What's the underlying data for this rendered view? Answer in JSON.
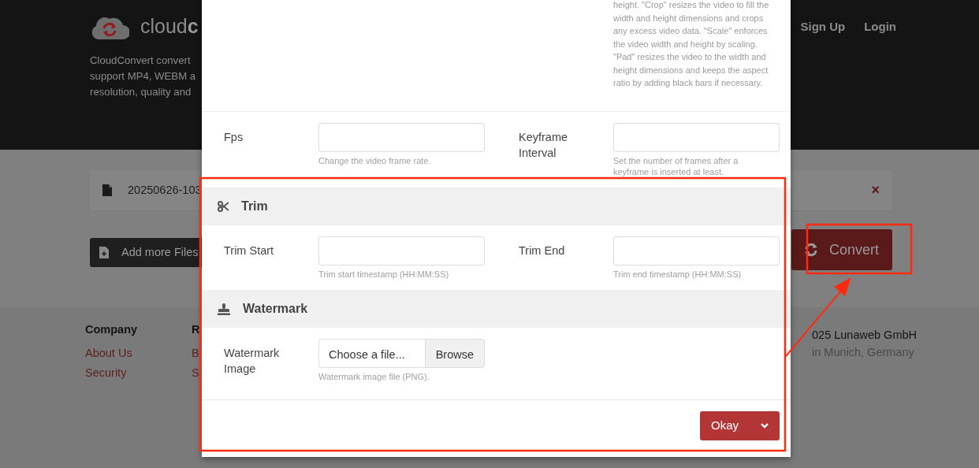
{
  "header": {
    "logo_text": "cloud**c**",
    "description": [
      "CloudConvert convert",
      "support MP4, WEBM a",
      "resolution, quality and"
    ],
    "nav": [
      "Sign Up",
      "Login"
    ]
  },
  "file": {
    "name": "20250626-103",
    "remove": "×"
  },
  "actions": {
    "add_files": "Add more Files",
    "convert": "Convert"
  },
  "footer": {
    "columns": [
      {
        "heading": "Company",
        "links": [
          "About Us",
          "Security"
        ]
      },
      {
        "heading": "R",
        "links": [
          "B",
          "S"
        ]
      }
    ],
    "copyright": "025 Lunaweb GmbH",
    "location": "in Munich, Germany"
  },
  "modal": {
    "top_help": "height. \"Crop\" resizes the video to fill the width and height dimensions and crops any excess video data. \"Scale\" enforces the video width and height by scaling. \"Pad\" resizes the video to the width and height dimensions and keeps the aspect ratio by adding black bars if necessary.",
    "sections": [
      {
        "kind": "fields",
        "fields": [
          {
            "kind": "text",
            "label": "Fps",
            "help": "Change the video frame rate."
          },
          {
            "kind": "text",
            "label": "Keyframe Interval",
            "help": "Set the number of frames after a keyframe is inserted at least."
          }
        ]
      },
      {
        "kind": "heading",
        "title": "Trim"
      },
      {
        "kind": "fields",
        "fields": [
          {
            "kind": "text",
            "label": "Trim Start",
            "help": "Trim start timestamp (HH:MM:SS)"
          },
          {
            "kind": "text",
            "label": "Trim End",
            "help": "Trim end timestamp (HH:MM:SS)"
          }
        ]
      },
      {
        "kind": "heading",
        "title": "Watermark"
      },
      {
        "kind": "fields",
        "fields": [
          {
            "kind": "file",
            "label": "Watermark Image",
            "text": "Choose a file...",
            "button": "Browse",
            "help": "Watermark image file (PNG)."
          }
        ]
      }
    ],
    "okay": "Okay"
  },
  "annotations": [
    {
      "kind": "box"
    },
    {
      "kind": "box"
    },
    {
      "kind": "arrow"
    }
  ]
}
